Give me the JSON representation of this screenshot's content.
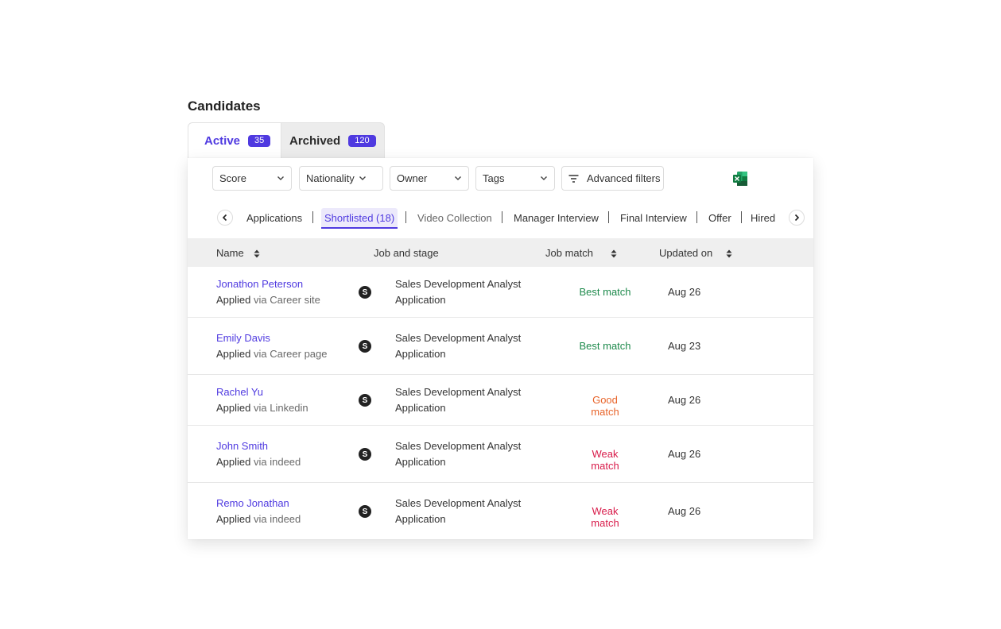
{
  "page_title": "Candidates",
  "tabs": [
    {
      "label": "Active",
      "count": "35"
    },
    {
      "label": "Archived",
      "count": "120"
    }
  ],
  "filters": {
    "score": "Score",
    "nationality": "Nationality",
    "owner": "Owner",
    "tags": "Tags",
    "advanced": "Advanced filters"
  },
  "export_icon": "excel-icon",
  "stages": {
    "applications": "Applications",
    "shortlisted": "Shortlisted (18)",
    "video": "Video Collection",
    "manager": "Manager Interview",
    "final": "Final Interview",
    "offer": "Offer",
    "hired": "Hired"
  },
  "columns": {
    "name": "Name",
    "job": "Job and stage",
    "match": "Job match",
    "updated": "Updated on"
  },
  "applied_prefix": "Applied",
  "rows": [
    {
      "name": "Jonathon Peterson",
      "via": "via Career site",
      "avatar": "S",
      "job": "Sales Development Analyst",
      "stage": "Application",
      "match": "Best match",
      "date": "Aug 26"
    },
    {
      "name": "Emily Davis",
      "via": "via Career page",
      "avatar": "S",
      "job": "Sales Development Analyst",
      "stage": "Application",
      "match": "Best match",
      "date": "Aug 23"
    },
    {
      "name": "Rachel Yu",
      "via": "via Linkedin",
      "avatar": "S",
      "job": "Sales Development Analyst",
      "stage": "Application",
      "match": "Good match",
      "date": "Aug 26"
    },
    {
      "name": "John Smith",
      "via": "via indeed",
      "avatar": "S",
      "job": "Sales Development Analyst",
      "stage": "Application",
      "match": "Weak match",
      "date": "Aug 26"
    },
    {
      "name": "Remo Jonathan",
      "via": "via indeed",
      "avatar": "S",
      "job": "Sales Development Analyst",
      "stage": "Application",
      "match": "Weak match",
      "date": "Aug 26"
    }
  ],
  "colors": {
    "accent": "#4f3ae0",
    "best": "#1e8a4c",
    "good": "#e8642a",
    "weak": "#d81b4a"
  }
}
